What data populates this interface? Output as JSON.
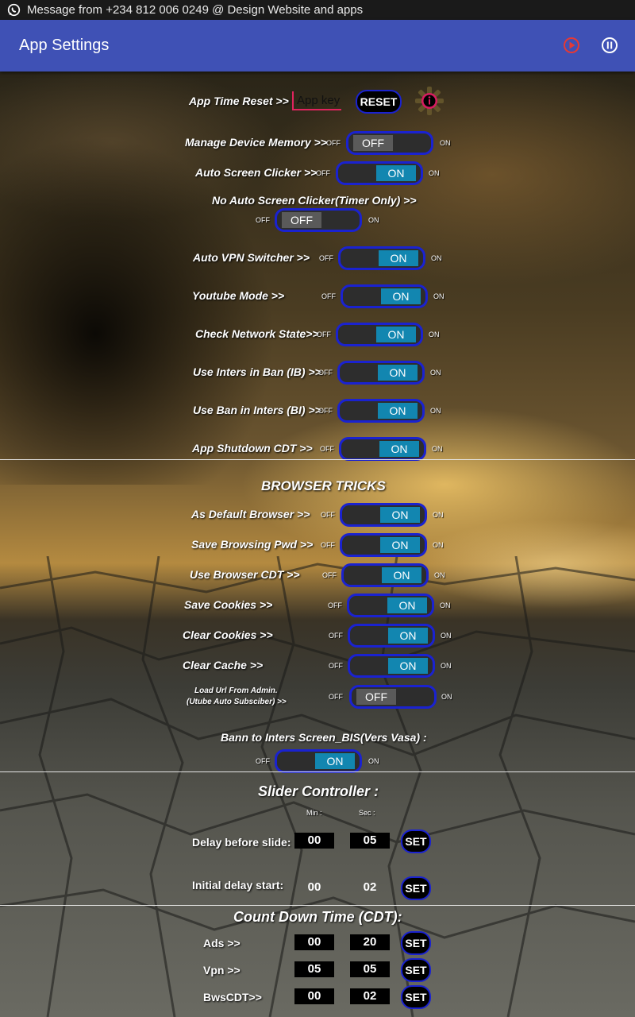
{
  "status_bar": {
    "message": "Message from +234 812 006 0249 @ Design Website and apps",
    "icon": "whatsapp-icon"
  },
  "app_bar": {
    "title": "App Settings",
    "icons": [
      "record-icon",
      "pause-icon"
    ]
  },
  "app_time_reset": {
    "label": "App Time Reset >>",
    "input_placeholder": "App key",
    "reset_label": "RESET",
    "info_icon": "info-icon"
  },
  "switch_words": {
    "off": "OFF",
    "on": "ON"
  },
  "toggles": [
    {
      "label": "Manage Device Memory >>",
      "state": "OFF"
    },
    {
      "label": "Auto Screen Clicker >>",
      "state": "ON"
    },
    {
      "label": "No Auto Screen Clicker(Timer Only) >>",
      "state": "OFF"
    },
    {
      "label": "Auto VPN Switcher >>",
      "state": "ON"
    },
    {
      "label": "Youtube Mode >>",
      "state": "ON"
    },
    {
      "label": "Check Network State>>",
      "state": "ON"
    },
    {
      "label": "Use Inters in Ban (IB) >>",
      "state": "ON"
    },
    {
      "label": "Use Ban in Inters (BI) >>",
      "state": "ON"
    },
    {
      "label": "App Shutdown CDT >>",
      "state": "ON"
    }
  ],
  "browser": {
    "heading": "BROWSER TRICKS",
    "toggles": [
      {
        "label": "As Default Browser  >>",
        "state": "ON"
      },
      {
        "label": "Save Browsing Pwd >>",
        "state": "ON"
      },
      {
        "label": "Use Browser CDT >>",
        "state": "ON"
      },
      {
        "label": "Save Cookies >>",
        "state": "ON"
      },
      {
        "label": "Clear Cookies >>",
        "state": "ON"
      },
      {
        "label": "Clear Cache >>",
        "state": "ON"
      },
      {
        "label_line1": "Load Url From Admin.",
        "label_line2": "(Utube Auto Subsciber)  >>",
        "state": "OFF"
      },
      {
        "label": "Bann to Inters Screen_BIS(Vers Vasa) :",
        "state": "ON"
      }
    ]
  },
  "slider": {
    "heading": "Slider Controller :",
    "min_label": "Min :",
    "sec_label": "Sec :",
    "rows": [
      {
        "label": "Delay before slide:",
        "min": "00",
        "sec": "05",
        "button": "SET"
      },
      {
        "label": "Initial delay  start:",
        "min": "00",
        "sec": "02",
        "button": "SET"
      }
    ]
  },
  "cdt": {
    "heading": "Count Down Time (CDT):",
    "rows": [
      {
        "label": "Ads >>",
        "min": "00",
        "sec": "20",
        "button": "SET"
      },
      {
        "label": "Vpn >>",
        "min": "05",
        "sec": "05",
        "button": "SET"
      },
      {
        "label": "BwsCDT>>",
        "min": "00",
        "sec": "02",
        "button": "SET"
      }
    ]
  }
}
